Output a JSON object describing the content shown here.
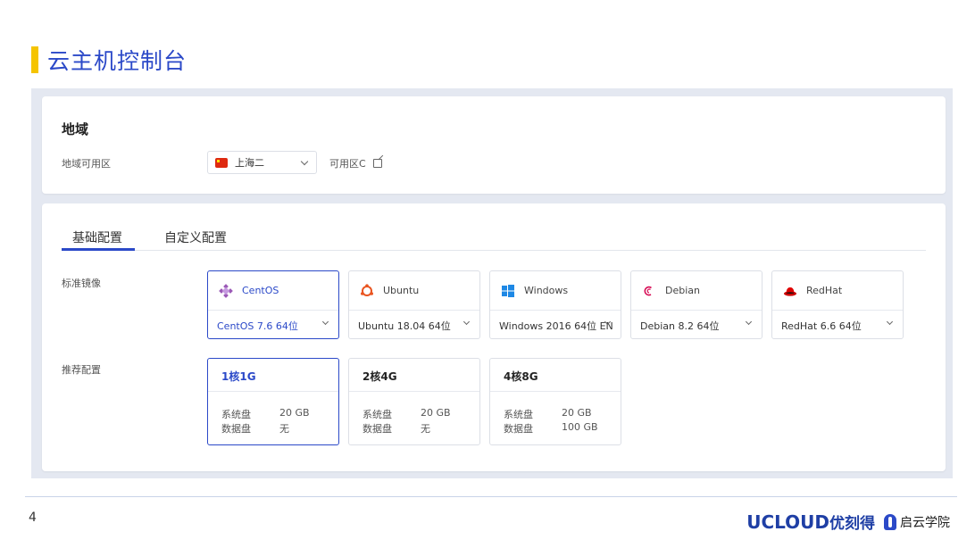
{
  "slide": {
    "title": "云主机控制台",
    "page_number": "4"
  },
  "region": {
    "title": "地域",
    "zone_label": "地域可用区",
    "selected_region": "上海二",
    "zone": "可用区C"
  },
  "tabs": [
    {
      "label": "基础配置",
      "active": true
    },
    {
      "label": "自定义配置",
      "active": false
    }
  ],
  "images": {
    "label": "标准镜像",
    "items": [
      {
        "name": "CentOS",
        "version": "CentOS 7.6 64位",
        "icon": "centos-icon",
        "selected": true
      },
      {
        "name": "Ubuntu",
        "version": "Ubuntu 18.04 64位",
        "icon": "ubuntu-icon",
        "selected": false
      },
      {
        "name": "Windows",
        "version": "Windows 2016 64位 EN",
        "icon": "windows-icon",
        "selected": false
      },
      {
        "name": "Debian",
        "version": "Debian 8.2 64位",
        "icon": "debian-icon",
        "selected": false
      },
      {
        "name": "RedHat",
        "version": "RedHat 6.6 64位",
        "icon": "redhat-icon",
        "selected": false
      }
    ]
  },
  "recommend": {
    "label": "推荐配置",
    "system_disk_label": "系统盘",
    "data_disk_label": "数据盘",
    "items": [
      {
        "title": "1核1G",
        "system_disk": "20 GB",
        "data_disk": "无",
        "selected": true
      },
      {
        "title": "2核4G",
        "system_disk": "20 GB",
        "data_disk": "无",
        "selected": false
      },
      {
        "title": "4核8G",
        "system_disk": "20 GB",
        "data_disk": "100 GB",
        "selected": false
      }
    ]
  },
  "brand": {
    "ucloud": "UCLOUD",
    "ucloud_cn": "优刻得",
    "academy": "启云学院"
  },
  "colors": {
    "accent": "#2b49c8",
    "title_bar": "#f5c400",
    "stage_bg": "#e4e8f1"
  }
}
